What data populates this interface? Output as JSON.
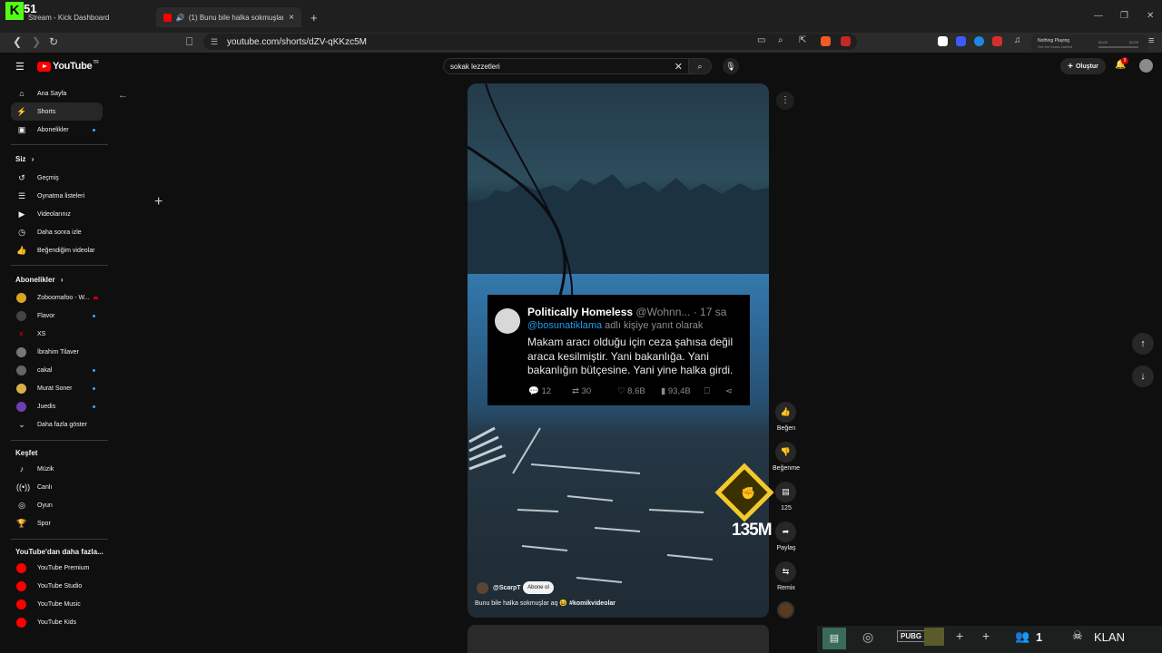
{
  "browser": {
    "tabs": [
      {
        "label": "Stream - Kick Dashboard"
      },
      {
        "label": "(1) Bunu bile halka sokmuşlar"
      }
    ],
    "url": "youtube.com/shorts/dZV-qKKzc5M",
    "kick_badge": "51",
    "now_playing": {
      "title": "Nothing Playing",
      "subtitle": "Get the music started",
      "time_start": "00:00",
      "time_end": "00:00"
    }
  },
  "header": {
    "logo_text": "YouTube",
    "country": "TR",
    "search_value": "sokak lezzetleri",
    "create_label": "Oluştur",
    "notif_count": "9"
  },
  "sidebar": {
    "main": [
      {
        "label": "Ana Sayfa",
        "icon": "home-icon"
      },
      {
        "label": "Shorts",
        "icon": "shorts-icon"
      },
      {
        "label": "Abonelikler",
        "icon": "subscriptions-icon"
      }
    ],
    "you_title": "Siz",
    "you": [
      {
        "label": "Geçmiş"
      },
      {
        "label": "Oynatma listeleri"
      },
      {
        "label": "Videolarınız"
      },
      {
        "label": "Daha sonra izle"
      },
      {
        "label": "Beğendiğim videolar"
      }
    ],
    "subs_title": "Abonelikler",
    "subs": [
      {
        "label": "Zoboomafoo - W...",
        "color": "#d9a520"
      },
      {
        "label": "Flavor",
        "color": "#444444"
      },
      {
        "label": "XS",
        "color": "#cc0000"
      },
      {
        "label": "İbrahim Tilaver",
        "color": "#777777"
      },
      {
        "label": "cakal",
        "color": "#666666"
      },
      {
        "label": "Murat Soner",
        "color": "#d8b04a"
      },
      {
        "label": "Juedis",
        "color": "#6c3fb5"
      }
    ],
    "show_more": "Daha fazla göster",
    "explore_title": "Keşfet",
    "explore": [
      {
        "label": "Müzik"
      },
      {
        "label": "Canlı"
      },
      {
        "label": "Oyun"
      },
      {
        "label": "Spor"
      }
    ],
    "more_title": "YouTube'dan daha fazla...",
    "more": [
      {
        "label": "YouTube Premium"
      },
      {
        "label": "YouTube Studio"
      },
      {
        "label": "YouTube Music"
      },
      {
        "label": "YouTube Kids"
      }
    ]
  },
  "short": {
    "tweet": {
      "name": "Politically Homeless",
      "handle": "@Wohnn... · 17 sa",
      "reply_mention": "@bosunatiklama",
      "reply_rest": " adlı kişiye yanıt olarak",
      "body": "Makam aracı olduğu için ceza şahısa değil araca kesilmiştir. Yani bakanlığa. Yani bakanlığın bütçesine. Yani yine halka girdi.",
      "replies": "12",
      "retweets": "30",
      "likes": "8,6B",
      "views": "93,4B"
    },
    "overlay_number": "135M",
    "channel": "@ScarpT",
    "subscribe": "Abone ol",
    "title": "Bunu bile halka sokmuşlar aq 😆",
    "hashtag": "#komikvideolar"
  },
  "actions": {
    "like": "Beğen",
    "dislike": "Beğenme",
    "comments": "125",
    "share": "Paylaş",
    "remix": "Remix"
  },
  "overlay": {
    "viewers": "1",
    "team": "KLAN"
  }
}
